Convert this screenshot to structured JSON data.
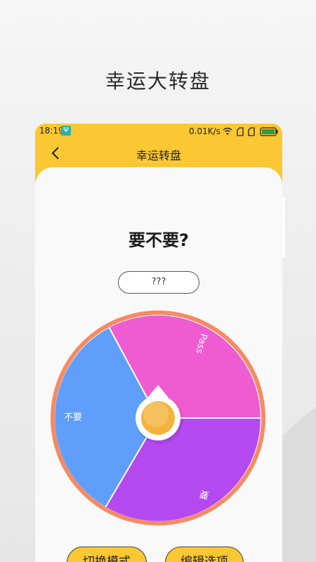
{
  "promo": {
    "title": "幸运大转盘"
  },
  "status_bar": {
    "time": "18:19",
    "speed": "0.01K/s"
  },
  "nav": {
    "title": "幸运转盘"
  },
  "main": {
    "question": "要不要?",
    "result": "???",
    "wheel": {
      "segments": [
        {
          "label": "Pass",
          "color": "#ef5bd0"
        },
        {
          "label": "要",
          "color": "#b449f0"
        },
        {
          "label": "不要",
          "color": "#5f9ffb"
        }
      ],
      "rim_color": "#f58a63",
      "center_color": "#f4b43c"
    },
    "buttons": {
      "mode": "切换模式",
      "edit": "编辑选项"
    }
  },
  "colors": {
    "accent": "#fbc833",
    "background": "#f9f9f9"
  }
}
